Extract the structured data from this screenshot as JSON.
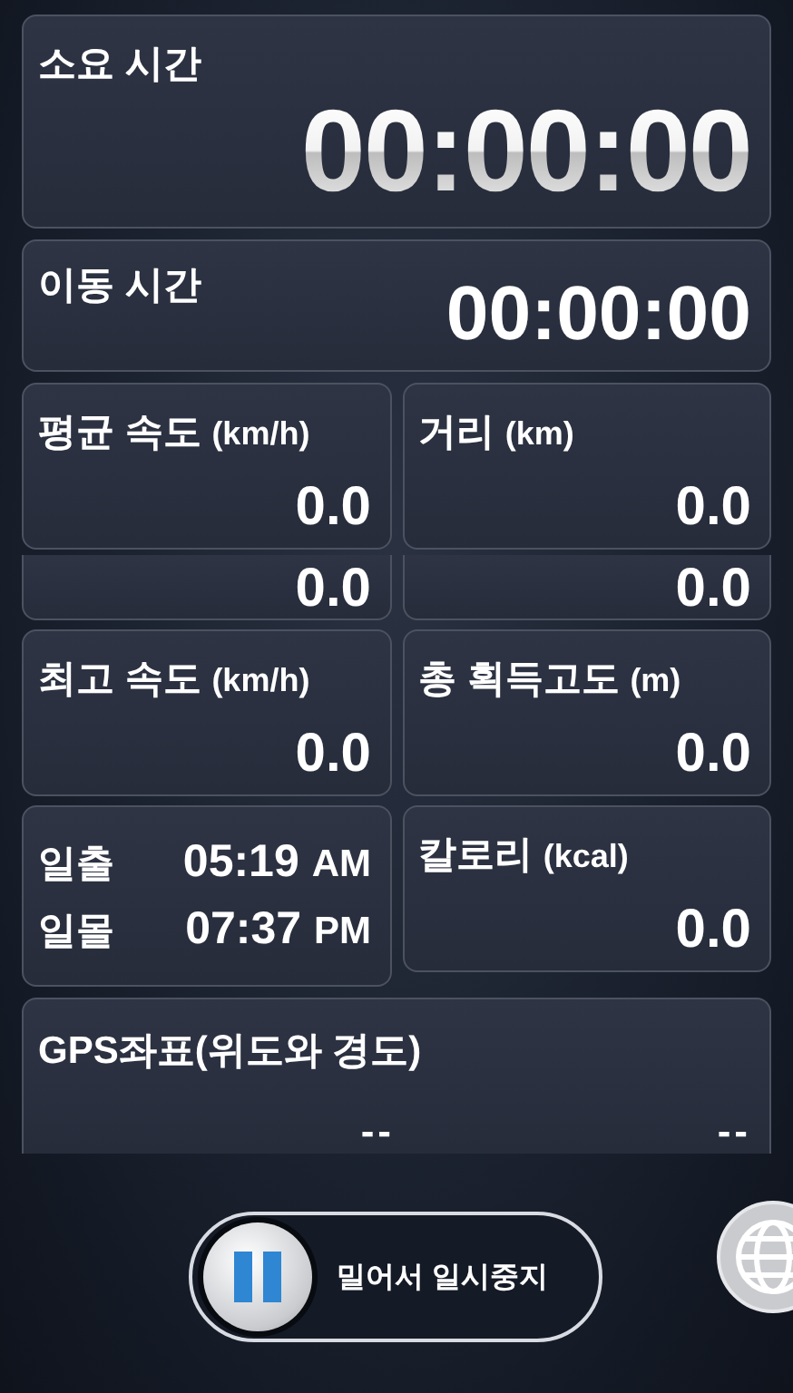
{
  "elapsed": {
    "label": "소요 시간",
    "value": "00:00:00"
  },
  "moving": {
    "label": "이동 시간",
    "value": "00:00:00"
  },
  "tiles": [
    {
      "kind": "stat",
      "label": "평균 속도",
      "unit": "(km/h)",
      "value": "0.0"
    },
    {
      "kind": "stat",
      "label": "거리",
      "unit": "(km)",
      "value": "0.0"
    },
    {
      "kind": "partial",
      "value": "0.0"
    },
    {
      "kind": "partial",
      "value": "0.0"
    },
    {
      "kind": "stat",
      "label": "최고 속도",
      "unit": "(km/h)",
      "value": "0.0"
    },
    {
      "kind": "stat",
      "label": "총 획득고도",
      "unit": "(m)",
      "value": "0.0"
    },
    {
      "kind": "sun",
      "rows": [
        {
          "label": "일출",
          "time": "05:19",
          "suffix": "AM"
        },
        {
          "label": "일몰",
          "time": "07:37",
          "suffix": "PM"
        }
      ]
    },
    {
      "kind": "stat",
      "label": "칼로리",
      "unit": "(kcal)",
      "value": "0.0"
    }
  ],
  "gps": {
    "label": "GPS좌표(위도와 경도)",
    "latitude": "--",
    "longitude": "--"
  },
  "slider": {
    "label": "밀어서 일시중지",
    "level": 0
  }
}
